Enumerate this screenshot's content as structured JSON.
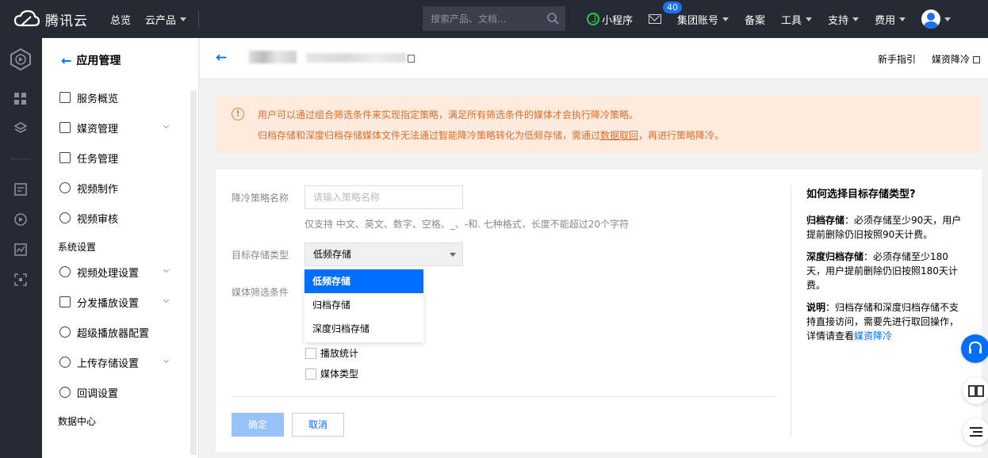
{
  "topbar": {
    "brand": "腾讯云",
    "nav": [
      "总览",
      "云产品"
    ],
    "search_placeholder": "搜索产品、文档...",
    "mini_program": "小程序",
    "mail_count": "40",
    "account": "集团账号",
    "record": "备案",
    "tools": "工具",
    "support": "支持",
    "fees": "费用"
  },
  "sidebar": {
    "title": "应用管理",
    "items": [
      {
        "label": "服务概览",
        "icon": "grid-icon"
      },
      {
        "label": "媒资管理",
        "icon": "play-square-icon",
        "expand": true
      },
      {
        "label": "任务管理",
        "icon": "check-square-icon"
      },
      {
        "label": "视频制作",
        "icon": "play-icon"
      },
      {
        "label": "视频审核",
        "icon": "review-icon"
      }
    ],
    "section_system": "系统设置",
    "system_items": [
      {
        "label": "视频处理设置",
        "icon": "video-process-icon",
        "expand": true
      },
      {
        "label": "分发播放设置",
        "icon": "cube-icon",
        "expand": true
      },
      {
        "label": "超级播放器配置",
        "icon": "player-icon"
      },
      {
        "label": "上传存储设置",
        "icon": "upload-icon",
        "expand": true
      },
      {
        "label": "回调设置",
        "icon": "callback-icon"
      }
    ],
    "section_data": "数据中心"
  },
  "header": {
    "links": [
      "新手指引",
      "媒资降冷"
    ]
  },
  "alert": {
    "line1": "用户可以通过组合筛选条件来实现指定策略，满足所有筛选条件的媒体才会执行降冷策略。",
    "line2_pre": "归档存储和深度归档存储媒体文件无法通过智能降冷策略转化为低频存储，需通过",
    "line2_link": "数据取回",
    "line2_post": "，再进行策略降冷。"
  },
  "form": {
    "name_label": "降冷策略名称",
    "name_placeholder": "请输入策略名称",
    "name_hint": "仅支持 中文、英文、数字、空格、_、-和. 七种格式，长度不能超过20个字符",
    "storage_label": "目标存储类型",
    "storage_value": "低频存储",
    "storage_options": [
      "低频存储",
      "归档存储",
      "深度归档存储"
    ],
    "filter_label": "媒体筛选条件",
    "filters": [
      "播放统计",
      "媒体类型"
    ],
    "ok": "确定",
    "cancel": "取消"
  },
  "help": {
    "title": "如何选择目标存储类型?",
    "p1_bold": "归档存储",
    "p1": "：必须存储至少90天，用户提前删除仍旧按照90天计费。",
    "p2_bold": "深度归档存储",
    "p2": "：必须存储至少180天，用户提前删除仍旧按照180天计费。",
    "p3_bold": "说明",
    "p3": "：归档存储和深度归档存储不支持直接访问，需要先进行取回操作，详情请查看",
    "p3_link": "媒资降冷"
  },
  "colors": {
    "accent": "#006eff",
    "topbar": "#262a33",
    "alert_bg": "#fcebde",
    "alert_text": "#e06d28"
  }
}
